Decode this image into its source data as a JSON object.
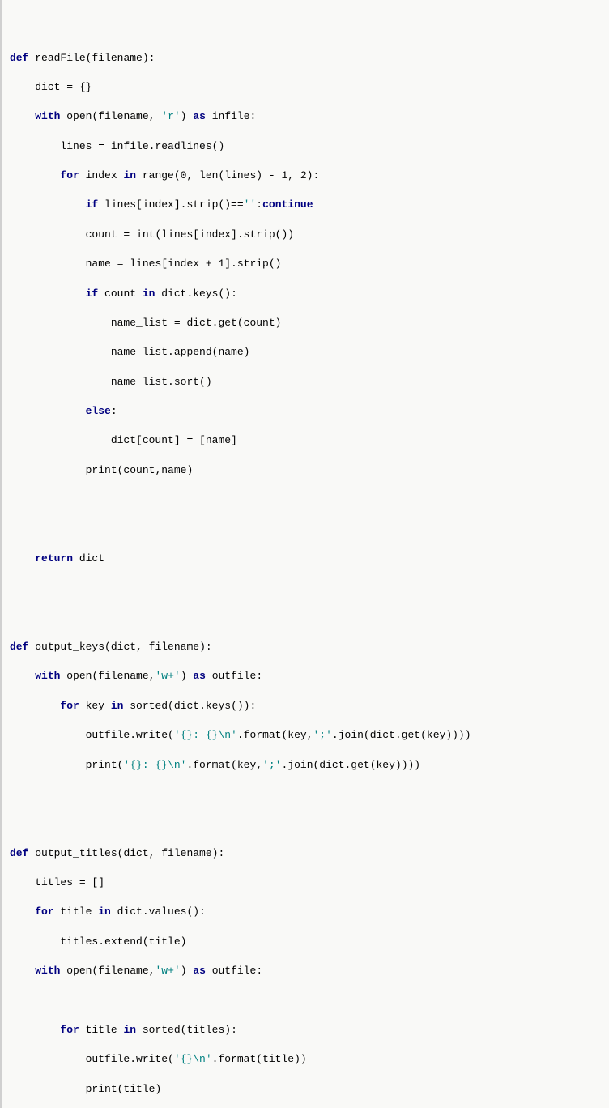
{
  "code": {
    "l1": {
      "kw1": "def",
      "name": "readFile",
      "params": "(filename):"
    },
    "l2": {
      "txt": "dict = {}"
    },
    "l3": {
      "kw1": "with",
      "mid": " open(filename, ",
      "str": "'r'",
      "kw2": "as",
      "tail": " infile:"
    },
    "l4": {
      "txt": "lines = infile.readlines()"
    },
    "l5": {
      "kw1": "for",
      "mid1": " index ",
      "kw2": "in",
      "mid2": " range(0, len(lines) - 1, 2):"
    },
    "l6": {
      "kw1": "if",
      "mid": " lines[index].strip()==",
      "str": "''",
      "colon": ":",
      "kw2": "continue"
    },
    "l7": {
      "txt": "count = int(lines[index].strip())"
    },
    "l8": {
      "txt": "name = lines[index + 1].strip()"
    },
    "l9": {
      "kw1": "if",
      "mid": " count ",
      "kw2": "in",
      "tail": " dict.keys():"
    },
    "l10": {
      "txt": "name_list = dict.get(count)"
    },
    "l11": {
      "txt": "name_list.append(name)"
    },
    "l12": {
      "txt": "name_list.sort()"
    },
    "l13": {
      "kw1": "else",
      "colon": ":"
    },
    "l14": {
      "txt": "dict[count] = [name]"
    },
    "l15": {
      "txt": "print(count,name)"
    },
    "l16": {
      "kw1": "return",
      "tail": " dict"
    },
    "l17": {
      "kw1": "def",
      "name": "output_keys",
      "params": "(dict, filename):"
    },
    "l18": {
      "kw1": "with",
      "mid": " open(filename,",
      "str": "'w+'",
      "kw2": "as",
      "tail": " outfile:"
    },
    "l19": {
      "kw1": "for",
      "mid1": " key ",
      "kw2": "in",
      "mid2": " sorted(dict.keys()):"
    },
    "l20": {
      "pre": "outfile.write(",
      "str": "'{}: {}\\n'",
      "mid": ".format(key,",
      "str2": "';'",
      "tail": ".join(dict.get(key))))"
    },
    "l21": {
      "pre": "print(",
      "str": "'{}: {}\\n'",
      "mid": ".format(key,",
      "str2": "';'",
      "tail": ".join(dict.get(key))))"
    },
    "l22": {
      "kw1": "def",
      "name": "output_titles",
      "params": "(dict, filename):"
    },
    "l23": {
      "txt": "titles = []"
    },
    "l24": {
      "kw1": "for",
      "mid1": " title ",
      "kw2": "in",
      "mid2": " dict.values():"
    },
    "l25": {
      "txt": "titles.extend(title)"
    },
    "l26": {
      "kw1": "with",
      "mid": " open(filename,",
      "str": "'w+'",
      "kw2": "as",
      "tail": " outfile:"
    },
    "l27": {
      "kw1": "for",
      "mid1": " title ",
      "kw2": "in",
      "mid2": " sorted(titles):"
    },
    "l28": {
      "pre": "outfile.write(",
      "str": "'{}\\n'",
      "tail": ".format(title))"
    },
    "l29": {
      "txt": "print(title)"
    }
  }
}
